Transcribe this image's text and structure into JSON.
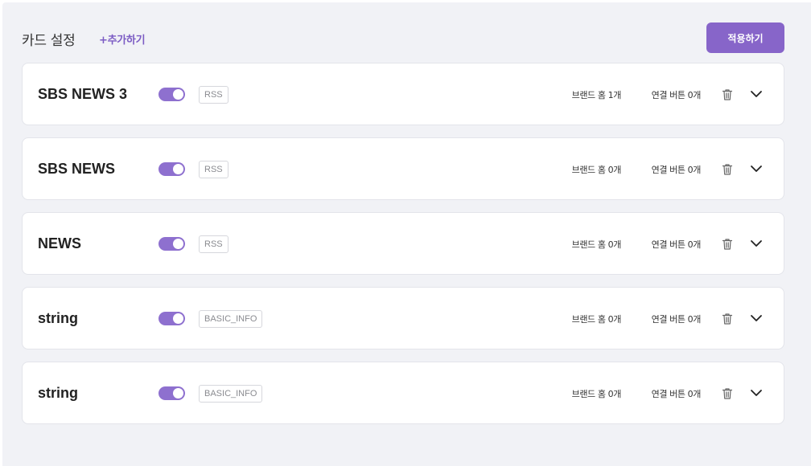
{
  "header": {
    "title": "카드 설정",
    "add_label": "+추가하기",
    "apply_label": "적용하기"
  },
  "colors": {
    "accent": "#8765c9",
    "toggle_on": "#8e70cf",
    "panel_bg": "#f1f2f6"
  },
  "cards": [
    {
      "name": "SBS NEWS 3",
      "enabled": true,
      "type": "RSS",
      "brand_home": "브랜드 홈 1개",
      "link_button": "연결 버튼 0개",
      "delete_icon": "trash-icon",
      "expand_icon": "chevron-down-icon"
    },
    {
      "name": "SBS NEWS",
      "enabled": true,
      "type": "RSS",
      "brand_home": "브랜드 홈 0개",
      "link_button": "연결 버튼 0개",
      "delete_icon": "trash-icon",
      "expand_icon": "chevron-down-icon"
    },
    {
      "name": "NEWS",
      "enabled": true,
      "type": "RSS",
      "brand_home": "브랜드 홈 0개",
      "link_button": "연결 버튼 0개",
      "delete_icon": "trash-icon",
      "expand_icon": "chevron-down-icon"
    },
    {
      "name": "string",
      "enabled": true,
      "type": "BASIC_INFO",
      "brand_home": "브랜드 홈 0개",
      "link_button": "연결 버튼 0개",
      "delete_icon": "trash-icon",
      "expand_icon": "chevron-down-icon"
    },
    {
      "name": "string",
      "enabled": true,
      "type": "BASIC_INFO",
      "brand_home": "브랜드 홈 0개",
      "link_button": "연결 버튼 0개",
      "delete_icon": "trash-icon",
      "expand_icon": "chevron-down-icon"
    }
  ]
}
